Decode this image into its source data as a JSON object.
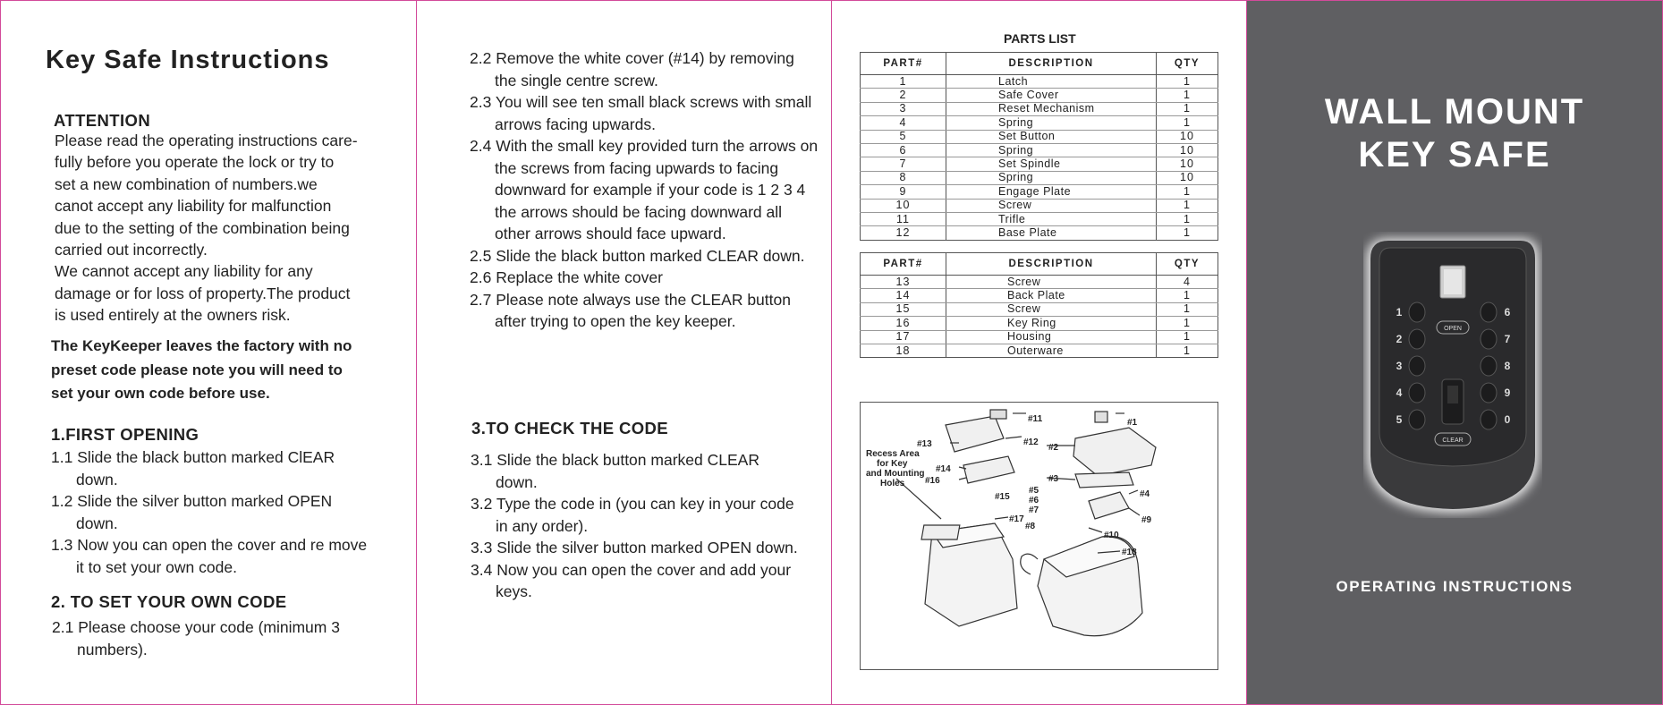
{
  "panel1": {
    "title": "Key Safe Instructions",
    "attention_heading": "ATTENTION",
    "attention_lines": [
      "Please read the operating instructions care-",
      "fully before you operate the lock or try to",
      "set a new combination of numbers.we",
      "canot accept any liability for malfunction",
      "due to the setting of the combination being",
      "carried out incorrectly.",
      "We cannot accept any liability for any",
      "damage or for loss of property.The product",
      "is used entirely at the owners risk."
    ],
    "notice_lines": [
      "The KeyKeeper leaves the factory with no",
      "preset code please note you will need to",
      "set your own code before use."
    ],
    "first_opening_heading": "1.FIRST OPENING",
    "first_opening_steps": [
      "1.1 Slide the black button marked ClEAR down.",
      "1.2 Slide the silver button marked OPEN down.",
      "1.3 Now you can open the cover and re move it to set your own code."
    ],
    "set_code_heading": "2. TO SET YOUR OWN CODE",
    "set_code_steps": [
      "2.1 Please choose your code (minimum 3 numbers)."
    ]
  },
  "panel2": {
    "steps": [
      "2.2 Remove the white cover (#14) by removing the single centre screw.",
      "2.3 You will see ten small black screws with small arrows facing upwards.",
      "2.4 With the small key provided turn the arrows on the screws from facing upwards to facing downward for example if your code is 1 2 3 4 the arrows should be facing downward all other arrows should face upward.",
      "2.5 Slide the black button marked CLEAR down.",
      "2.6 Replace the white cover",
      "2.7 Please note always use the CLEAR button after trying to open the key keeper."
    ],
    "check_heading": "3.TO CHECK THE CODE",
    "check_steps": [
      "3.1 Slide the black button marked CLEAR down.",
      "3.2 Type the code in (you can key in your code in any order).",
      "3.3 Slide the silver button marked OPEN down.",
      "3.4 Now you can open the cover and add your keys."
    ]
  },
  "panel3": {
    "parts_title": "PARTS LIST",
    "headers": [
      "PART#",
      "DESCRIPTION",
      "QTY"
    ],
    "table1": [
      [
        "1",
        "Latch",
        "1"
      ],
      [
        "2",
        "Safe Cover",
        "1"
      ],
      [
        "3",
        "Reset Mechanism",
        "1"
      ],
      [
        "4",
        "Spring",
        "1"
      ],
      [
        "5",
        "Set Button",
        "10"
      ],
      [
        "6",
        "Spring",
        "10"
      ],
      [
        "7",
        "Set Spindle",
        "10"
      ],
      [
        "8",
        "Spring",
        "10"
      ],
      [
        "9",
        "Engage Plate",
        "1"
      ],
      [
        "10",
        "Screw",
        "1"
      ],
      [
        "11",
        "Trifle",
        "1"
      ],
      [
        "12",
        "Base Plate",
        "1"
      ]
    ],
    "table2": [
      [
        "13",
        "Screw",
        "4"
      ],
      [
        "14",
        "Back Plate",
        "1"
      ],
      [
        "15",
        "Screw",
        "1"
      ],
      [
        "16",
        "Key Ring",
        "1"
      ],
      [
        "17",
        "Housing",
        "1"
      ],
      [
        "18",
        "Outerware",
        "1"
      ]
    ],
    "diagram": {
      "recess_label": [
        "Recess Area",
        "for Key",
        "and Mounting",
        "Holes"
      ],
      "labels": [
        "#1",
        "#2",
        "#3",
        "#4",
        "#5",
        "#6",
        "#7",
        "#8",
        "#9",
        "#10",
        "#11",
        "#12",
        "#13",
        "#14",
        "#15",
        "#16",
        "#17",
        "#18"
      ]
    }
  },
  "panel4": {
    "title_line1": "WALL  MOUNT",
    "title_line2": "KEY SAFE",
    "keypad_left": [
      "1",
      "2",
      "3",
      "4",
      "5"
    ],
    "keypad_right": [
      "6",
      "7",
      "8",
      "9",
      "0"
    ],
    "open_label": "OPEN",
    "clear_label": "CLEAR",
    "footer": "OPERATING INSTRUCTIONS"
  },
  "colors": {
    "fold_line": "#d24a9a",
    "cover_bg": "#5f5f62",
    "device_body": "#2c2c2e"
  }
}
